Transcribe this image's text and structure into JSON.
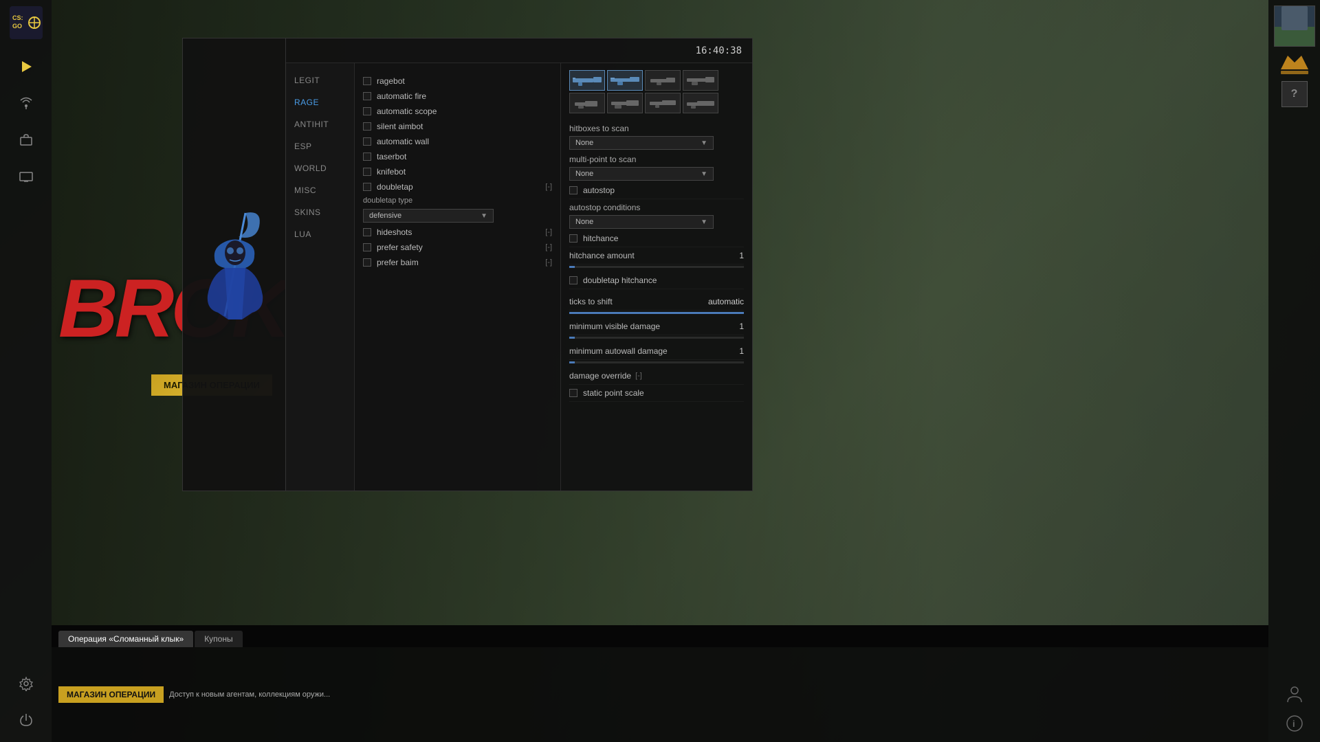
{
  "app": {
    "time": "16:40:38"
  },
  "left_sidebar": {
    "play_label": "▶",
    "antenna_label": "📡",
    "briefcase_label": "💼",
    "tv_label": "📺",
    "gear_label": "⚙",
    "power_label": "⏻"
  },
  "right_sidebar": {
    "rank_icon": "≡≡≡",
    "question_mark": "?",
    "info_label": "ℹ",
    "person_label": "👤"
  },
  "broke_text": "BROKE",
  "bottom": {
    "tabs": [
      {
        "label": "Операция «Сломанный клык»",
        "active": true
      },
      {
        "label": "Купоны",
        "active": false
      }
    ],
    "shop_banner": "МАГАЗИН ОПЕРАЦИИ",
    "shop_desc": "Доступ к новым агентам, коллекциям оружи..."
  },
  "nav": {
    "items": [
      {
        "label": "LEGIT",
        "active": false
      },
      {
        "label": "RAGE",
        "active": true
      },
      {
        "label": "ANTIHIT",
        "active": false
      },
      {
        "label": "ESP",
        "active": false
      },
      {
        "label": "WORLD",
        "active": false
      },
      {
        "label": "MISC",
        "active": false
      },
      {
        "label": "SKINS",
        "active": false
      },
      {
        "label": "LUA",
        "active": false
      }
    ]
  },
  "checkboxes": [
    {
      "label": "ragebot",
      "checked": false,
      "shortcut": ""
    },
    {
      "label": "automatic fire",
      "checked": false,
      "shortcut": ""
    },
    {
      "label": "automatic scope",
      "checked": false,
      "shortcut": ""
    },
    {
      "label": "silent aimbot",
      "checked": false,
      "shortcut": ""
    },
    {
      "label": "automatic wall",
      "checked": false,
      "shortcut": ""
    },
    {
      "label": "taserbot",
      "checked": false,
      "shortcut": ""
    },
    {
      "label": "knifebot",
      "checked": false,
      "shortcut": ""
    },
    {
      "label": "doubletap",
      "checked": false,
      "shortcut": "[-]"
    }
  ],
  "doubletap_type": {
    "label": "doubletap type",
    "value": "defensive"
  },
  "sub_checkboxes": [
    {
      "label": "hideshots",
      "checked": false,
      "shortcut": "[-]"
    },
    {
      "label": "prefer safety",
      "checked": false,
      "shortcut": "[-]"
    },
    {
      "label": "prefer baim",
      "checked": false,
      "shortcut": "[-]"
    }
  ],
  "right_panel": {
    "weapon_icons": [
      {
        "id": "w1",
        "active": true
      },
      {
        "id": "w2",
        "active": true
      },
      {
        "id": "w3",
        "active": false
      },
      {
        "id": "w4",
        "active": false
      },
      {
        "id": "w5",
        "active": false
      },
      {
        "id": "w6",
        "active": false
      },
      {
        "id": "w7",
        "active": false
      },
      {
        "id": "w8",
        "active": false
      }
    ],
    "hitboxes_to_scan": {
      "label": "hitboxes to scan",
      "value": "None"
    },
    "multi_point_to_scan": {
      "label": "multi-point to scan",
      "value": "None"
    },
    "autostop": {
      "label": "autostop",
      "checked": false
    },
    "autostop_conditions": {
      "label": "autostop conditions",
      "value": "None"
    },
    "hitchance": {
      "label": "hitchance",
      "checked": false
    },
    "hitchance_amount": {
      "label": "hitchance amount",
      "value": "1"
    },
    "doubletap_hitchance": {
      "label": "doubletap hitchance",
      "checked": false
    },
    "ticks_to_shift": {
      "label": "ticks to shift",
      "value": "automatic"
    },
    "minimum_visible_damage": {
      "label": "minimum visible damage",
      "value": "1"
    },
    "minimum_autowall_damage": {
      "label": "minimum autowall damage",
      "value": "1"
    },
    "damage_override": {
      "label": "damage override",
      "shortcut": "[-]"
    },
    "static_point_scale": {
      "label": "static point scale",
      "checked": false
    }
  }
}
